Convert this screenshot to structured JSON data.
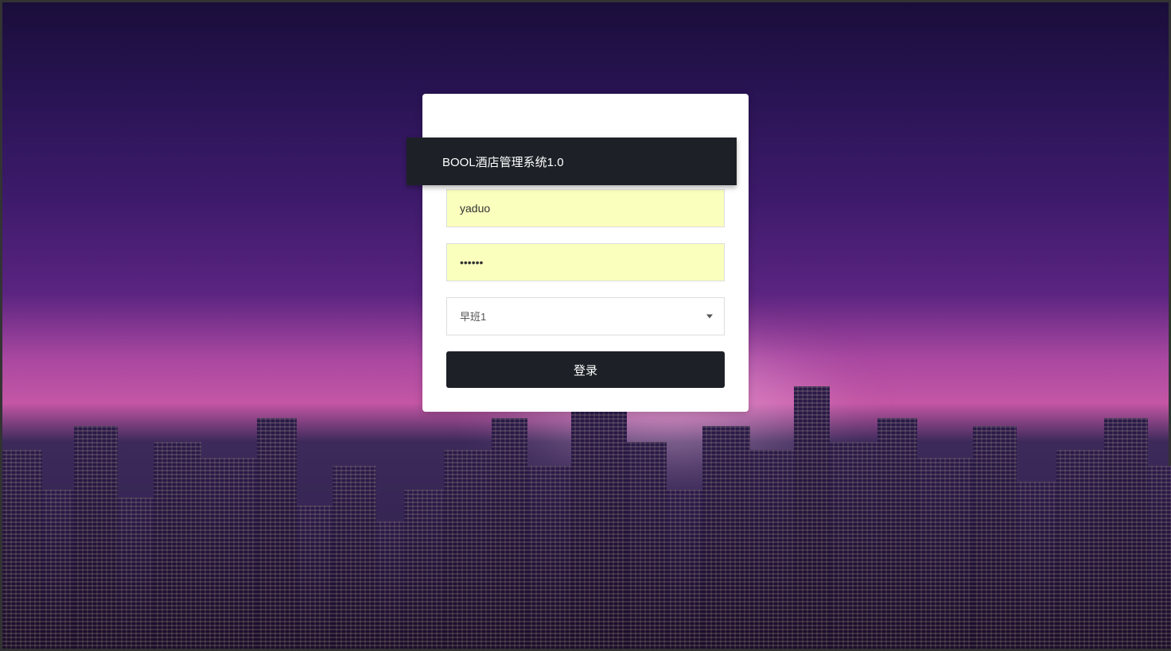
{
  "title": "BOOL酒店管理系统1.0",
  "form": {
    "username_value": "yaduo",
    "password_value": "••••••",
    "shift_selected": "早班1",
    "login_button_label": "登录"
  },
  "colors": {
    "panel_dark": "#1d2127",
    "autofill_bg": "#faffbd"
  }
}
